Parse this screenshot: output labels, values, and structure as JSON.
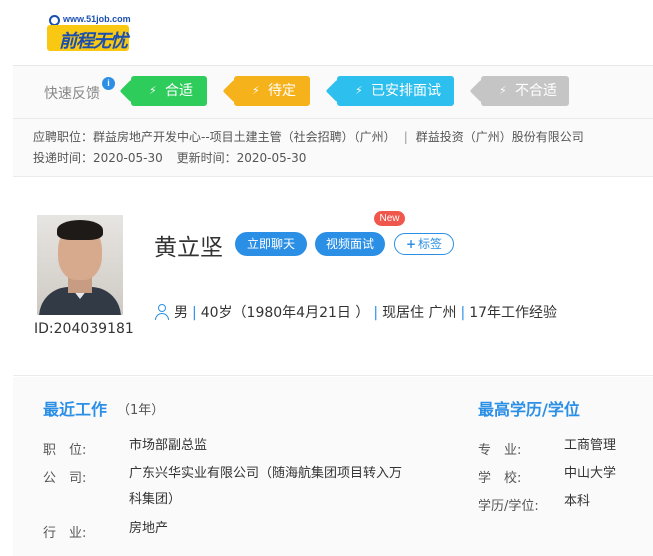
{
  "logo": {
    "url_text": "www.51job.com",
    "brand_text": "前程无忧"
  },
  "feedback": {
    "label": "快速反馈",
    "info_icon": "i",
    "tags": [
      {
        "label": "合适",
        "color": "#2ecc5b"
      },
      {
        "label": "待定",
        "color": "#f6b21a"
      },
      {
        "label": "已安排面试",
        "color": "#2dbfee"
      },
      {
        "label": "不合适",
        "color": "#c5c5c5"
      }
    ]
  },
  "application": {
    "position_label": "应聘职位：",
    "position_value": "群益房地产开发中心--项目土建主管（社会招聘）（广州）",
    "separator": "|",
    "company_value": "群益投资（广州）股份有限公司",
    "submit_label": "投递时间：",
    "submit_value": "2020-05-30",
    "update_label": "更新时间：",
    "update_value": "2020-05-30"
  },
  "profile": {
    "id_text": "ID:204039181",
    "name": "黄立坚",
    "chat_button": "立即聊天",
    "video_button": "视频面试",
    "new_badge": "New",
    "tag_button": "标签",
    "gender": "男",
    "age": "40岁（1980年4月21日 ）",
    "residence": "现居住 广州",
    "experience": "17年工作经验",
    "bar": "|"
  },
  "recent_work": {
    "title": "最近工作",
    "duration": "（1年）",
    "position_label": "职　位:",
    "position_value": "市场部副总监",
    "company_label": "公　司:",
    "company_value_line1": "广东兴华实业有限公司（随海航集团项目转入万",
    "company_value_line2": "科集团）",
    "industry_label": "行　业:",
    "industry_value": "房地产"
  },
  "education": {
    "title": "最高学历/学位",
    "major_label": "专　业:",
    "major_value": "工商管理",
    "school_label": "学　校:",
    "school_value": "中山大学",
    "degree_label": "学历/学位:",
    "degree_value": "本科"
  }
}
